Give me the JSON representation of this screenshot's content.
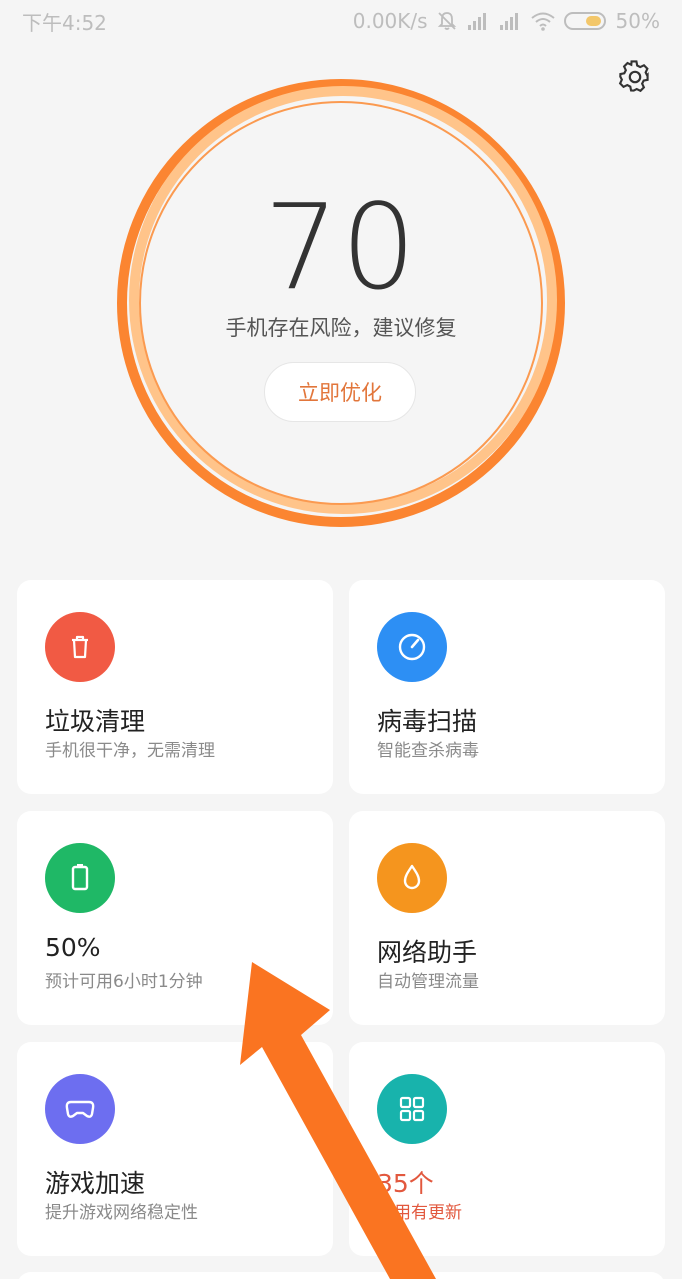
{
  "status_bar": {
    "time": "下午4:52",
    "network_speed": "0.00K/s",
    "battery_percent": "50%"
  },
  "header": {
    "settings_icon": "gear-icon"
  },
  "score": {
    "value": "70",
    "description": "手机存在风险，建议修复",
    "button_label": "立即优化"
  },
  "colors": {
    "ring_outer": "#fb8531",
    "ring_inner": "#ffc48a",
    "red": "#f15a44",
    "blue": "#2d8ff4",
    "green": "#1fb866",
    "orange": "#f5951e",
    "purple": "#6d6ef0",
    "teal": "#18b3ac",
    "arrow": "#fa7421"
  },
  "cards": [
    {
      "icon": "trash-icon",
      "title": "垃圾清理",
      "subtitle": "手机很干净，无需清理"
    },
    {
      "icon": "scan-icon",
      "title": "病毒扫描",
      "subtitle": "智能查杀病毒"
    },
    {
      "icon": "battery-icon",
      "title": "50%",
      "subtitle": "预计可用6小时1分钟"
    },
    {
      "icon": "drop-icon",
      "title": "网络助手",
      "subtitle": "自动管理流量"
    },
    {
      "icon": "gamepad-icon",
      "title": "游戏加速",
      "subtitle": "提升游戏网络稳定性"
    },
    {
      "icon": "apps-grid-icon",
      "title": "35个",
      "subtitle": "应用有更新"
    }
  ]
}
